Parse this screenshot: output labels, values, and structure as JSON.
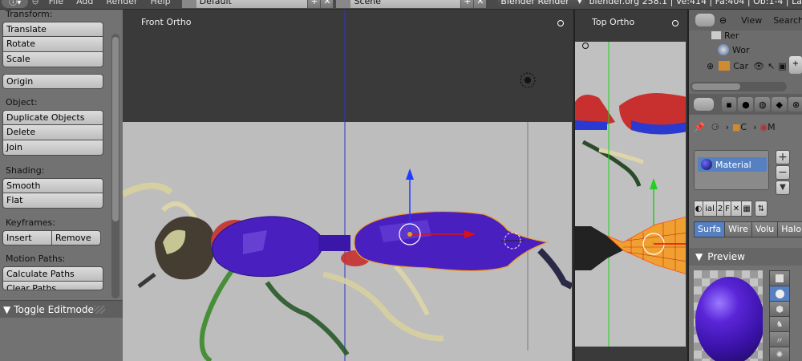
{
  "topbar": {
    "menus": [
      "File",
      "Add",
      "Render",
      "Help"
    ],
    "screen_layout": "Default",
    "scene": "Scene",
    "engine": "Blender Render",
    "stats": "blender.org 258.1 | Ve:414 | Fa:404 | Ob:1-4 | La"
  },
  "toolshelf": {
    "transform_label": "Transform:",
    "translate": "Translate",
    "rotate": "Rotate",
    "scale": "Scale",
    "origin": "Origin",
    "object_label": "Object:",
    "duplicate": "Duplicate Objects",
    "delete": "Delete",
    "join": "Join",
    "shading_label": "Shading:",
    "smooth": "Smooth",
    "flat": "Flat",
    "keyframes_label": "Keyframes:",
    "insert": "Insert",
    "remove": "Remove",
    "motion_label": "Motion Paths:",
    "calc_paths": "Calculate Paths",
    "clear_paths": "Clear Paths",
    "editmode": "Toggle Editmode"
  },
  "viewport_front": {
    "label": "Front Ortho"
  },
  "viewport_top": {
    "label": "Top Ortho"
  },
  "outliner": {
    "view": "View",
    "search": "Search",
    "rows": [
      "Rer",
      "Wor",
      "Car"
    ]
  },
  "properties": {
    "crumb_object": "C",
    "crumb_material": "M",
    "material_name": "Material",
    "matrow_name": "ial",
    "matrow_users": "2",
    "matrow_fake": "F",
    "tabs": [
      "Surfa",
      "Wire",
      "Volu",
      "Halo"
    ],
    "preview_label": "Preview"
  },
  "colors": {
    "selection_blue": "#5680c2",
    "mesh_purple": "#4a1fc0",
    "axis_red": "#e01010",
    "axis_green": "#20d020",
    "axis_blue": "#1f3cff"
  }
}
